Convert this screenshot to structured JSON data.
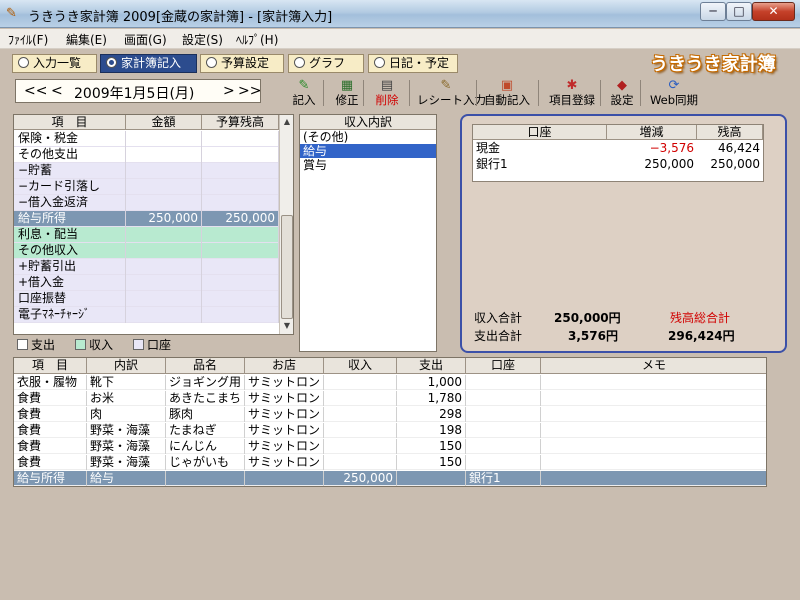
{
  "window": {
    "title": "うきうき家計簿 2009[金蔵の家計簿] - [家計簿入力]",
    "minimize": "─",
    "maximize": "□",
    "close": "✕"
  },
  "menu": [
    "ﾌｧｲﾙ(F)",
    "編集(E)",
    "画面(G)",
    "設定(S)",
    "ﾍﾙﾌﾟ(H)"
  ],
  "tabs": [
    {
      "label": "入力一覧",
      "active": false
    },
    {
      "label": "家計簿記入",
      "active": true
    },
    {
      "label": "予算設定",
      "active": false
    },
    {
      "label": "グラフ",
      "active": false
    },
    {
      "label": "日記・予定",
      "active": false
    }
  ],
  "logo": "うきうき家計簿",
  "date_nav": {
    "prev_month": "<<",
    "prev_day": "<",
    "date": "2009年1月5日(月)",
    "next_day": ">",
    "next_month": ">>"
  },
  "toolbar": [
    {
      "label": "記入",
      "icon": "pencil-icon",
      "glyph": "✎",
      "color": "#2b8a2b"
    },
    {
      "label": "修正",
      "icon": "edit-icon",
      "glyph": "▦",
      "color": "#2b6e2b"
    },
    {
      "label": "削除",
      "icon": "delete-icon",
      "glyph": "▤",
      "color": "#444444",
      "label_color": "#d10000"
    },
    {
      "label": "レシート入力",
      "icon": "receipt-icon",
      "glyph": "✎",
      "color": "#8a6a2b"
    },
    {
      "label": "自動記入",
      "icon": "auto-icon",
      "glyph": "▣",
      "color": "#c04a2b"
    },
    {
      "label": "項目登録",
      "icon": "register-icon",
      "glyph": "✱",
      "color": "#c02b2b"
    },
    {
      "label": "設定",
      "icon": "settings-icon",
      "glyph": "◆",
      "color": "#b02020"
    },
    {
      "label": "Web同期",
      "icon": "web-sync-icon",
      "glyph": "⟳",
      "color": "#2b5ec0"
    }
  ],
  "categories": {
    "headers": [
      "項　目",
      "金額",
      "予算残高"
    ],
    "rows": [
      {
        "name": "保険・税金",
        "amount": "",
        "budget": "",
        "kind": "expense"
      },
      {
        "name": "その他支出",
        "amount": "",
        "budget": "",
        "kind": "expense"
      },
      {
        "name": "−貯蓄",
        "amount": "",
        "budget": "",
        "kind": "asset"
      },
      {
        "name": "−カード引落し",
        "amount": "",
        "budget": "",
        "kind": "asset"
      },
      {
        "name": "−借入金返済",
        "amount": "",
        "budget": "",
        "kind": "asset"
      },
      {
        "name": "給与所得",
        "amount": "250,000",
        "budget": "250,000",
        "kind": "sel"
      },
      {
        "name": "利息・配当",
        "amount": "",
        "budget": "",
        "kind": "income"
      },
      {
        "name": "その他収入",
        "amount": "",
        "budget": "",
        "kind": "income"
      },
      {
        "name": "+貯蓄引出",
        "amount": "",
        "budget": "",
        "kind": "asset"
      },
      {
        "name": "+借入金",
        "amount": "",
        "budget": "",
        "kind": "asset"
      },
      {
        "name": "口座振替",
        "amount": "",
        "budget": "",
        "kind": "asset"
      },
      {
        "name": "電子ﾏﾈｰﾁｬｰｼﾞ",
        "amount": "",
        "budget": "",
        "kind": "asset"
      }
    ]
  },
  "legend": [
    {
      "label": "支出",
      "color": "#ffffff"
    },
    {
      "label": "収入",
      "color": "#b8ead0"
    },
    {
      "label": "口座",
      "color": "#e9e7f7"
    }
  ],
  "income_detail": {
    "header": "収入内訳",
    "items": [
      {
        "label": "(その他)",
        "selected": false
      },
      {
        "label": "給与",
        "selected": true
      },
      {
        "label": "賞与",
        "selected": false
      }
    ]
  },
  "accounts": {
    "headers": [
      "口座",
      "増減",
      "残高"
    ],
    "rows": [
      {
        "name": "現金",
        "change": "−3,576",
        "balance": "46,424",
        "negative": true
      },
      {
        "name": "銀行1",
        "change": "250,000",
        "balance": "250,000",
        "negative": false
      }
    ],
    "totals": {
      "income_label": "収入合計",
      "income_value": "250,000円",
      "expense_label": "支出合計",
      "expense_value": "3,576円",
      "balance_label": "残高総合計",
      "balance_value": "296,424円"
    }
  },
  "transactions": {
    "headers": [
      "項　目",
      "内訳",
      "品名",
      "お店",
      "収入",
      "支出",
      "口座",
      "メモ"
    ],
    "rows": [
      {
        "item": "衣服・履物",
        "detail": "靴下",
        "product": "ジョギング用",
        "shop": "サミットロン",
        "income": "",
        "expense": "1,000",
        "account": "",
        "memo": "",
        "selected": false
      },
      {
        "item": "食費",
        "detail": "お米",
        "product": "あきたこまち",
        "shop": "サミットロン",
        "income": "",
        "expense": "1,780",
        "account": "",
        "memo": "",
        "selected": false
      },
      {
        "item": "食費",
        "detail": "肉",
        "product": "豚肉",
        "shop": "サミットロン",
        "income": "",
        "expense": "298",
        "account": "",
        "memo": "",
        "selected": false
      },
      {
        "item": "食費",
        "detail": "野菜・海藻",
        "product": "たまねぎ",
        "shop": "サミットロン",
        "income": "",
        "expense": "198",
        "account": "",
        "memo": "",
        "selected": false
      },
      {
        "item": "食費",
        "detail": "野菜・海藻",
        "product": "にんじん",
        "shop": "サミットロン",
        "income": "",
        "expense": "150",
        "account": "",
        "memo": "",
        "selected": false
      },
      {
        "item": "食費",
        "detail": "野菜・海藻",
        "product": "じゃがいも",
        "shop": "サミットロン",
        "income": "",
        "expense": "150",
        "account": "",
        "memo": "",
        "selected": false
      },
      {
        "item": "給与所得",
        "detail": "給与",
        "product": "",
        "shop": "",
        "income": "250,000",
        "expense": "",
        "account": "銀行1",
        "memo": "",
        "selected": true
      }
    ]
  }
}
